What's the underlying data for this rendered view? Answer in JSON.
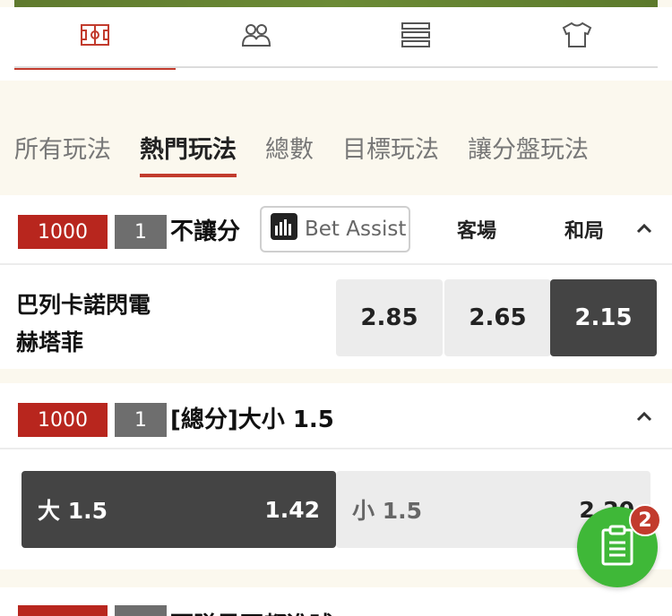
{
  "top_nav": {
    "items": [
      {
        "icon": "pitch-icon",
        "active": true
      },
      {
        "icon": "lineup-icon",
        "active": false
      },
      {
        "icon": "standings-icon",
        "active": false
      },
      {
        "icon": "jersey-icon",
        "active": false
      }
    ]
  },
  "market_tabs": [
    {
      "label": "所有玩法",
      "active": false
    },
    {
      "label": "熱門玩法",
      "active": true
    },
    {
      "label": "總數",
      "active": false
    },
    {
      "label": "目標玩法",
      "active": false
    },
    {
      "label": "讓分盤玩法",
      "active": false
    }
  ],
  "market1": {
    "badge_amount": "1000",
    "badge_count": "1",
    "title": "不讓分",
    "bet_assist_label": "Bet Assist",
    "col_away": "客場",
    "col_draw": "和局",
    "home_team": "巴列卡諾閃電",
    "away_team": "赫塔菲",
    "odds": [
      "2.85",
      "2.65",
      "2.15"
    ],
    "selected_index": 2
  },
  "market2": {
    "badge_amount": "1000",
    "badge_count": "1",
    "title": "[總分]大小 1.5",
    "over_label": "大 1.5",
    "over_odds": "1.42",
    "under_label": "小 1.5",
    "under_odds": "2.20"
  },
  "market3": {
    "title": "兩隊是否都進球"
  },
  "betslip": {
    "count": "2"
  },
  "colors": {
    "accent_red": "#c23b2d",
    "badge_red": "#b8261e",
    "selected_dark": "#444444",
    "betslip_green": "#3fb838"
  }
}
